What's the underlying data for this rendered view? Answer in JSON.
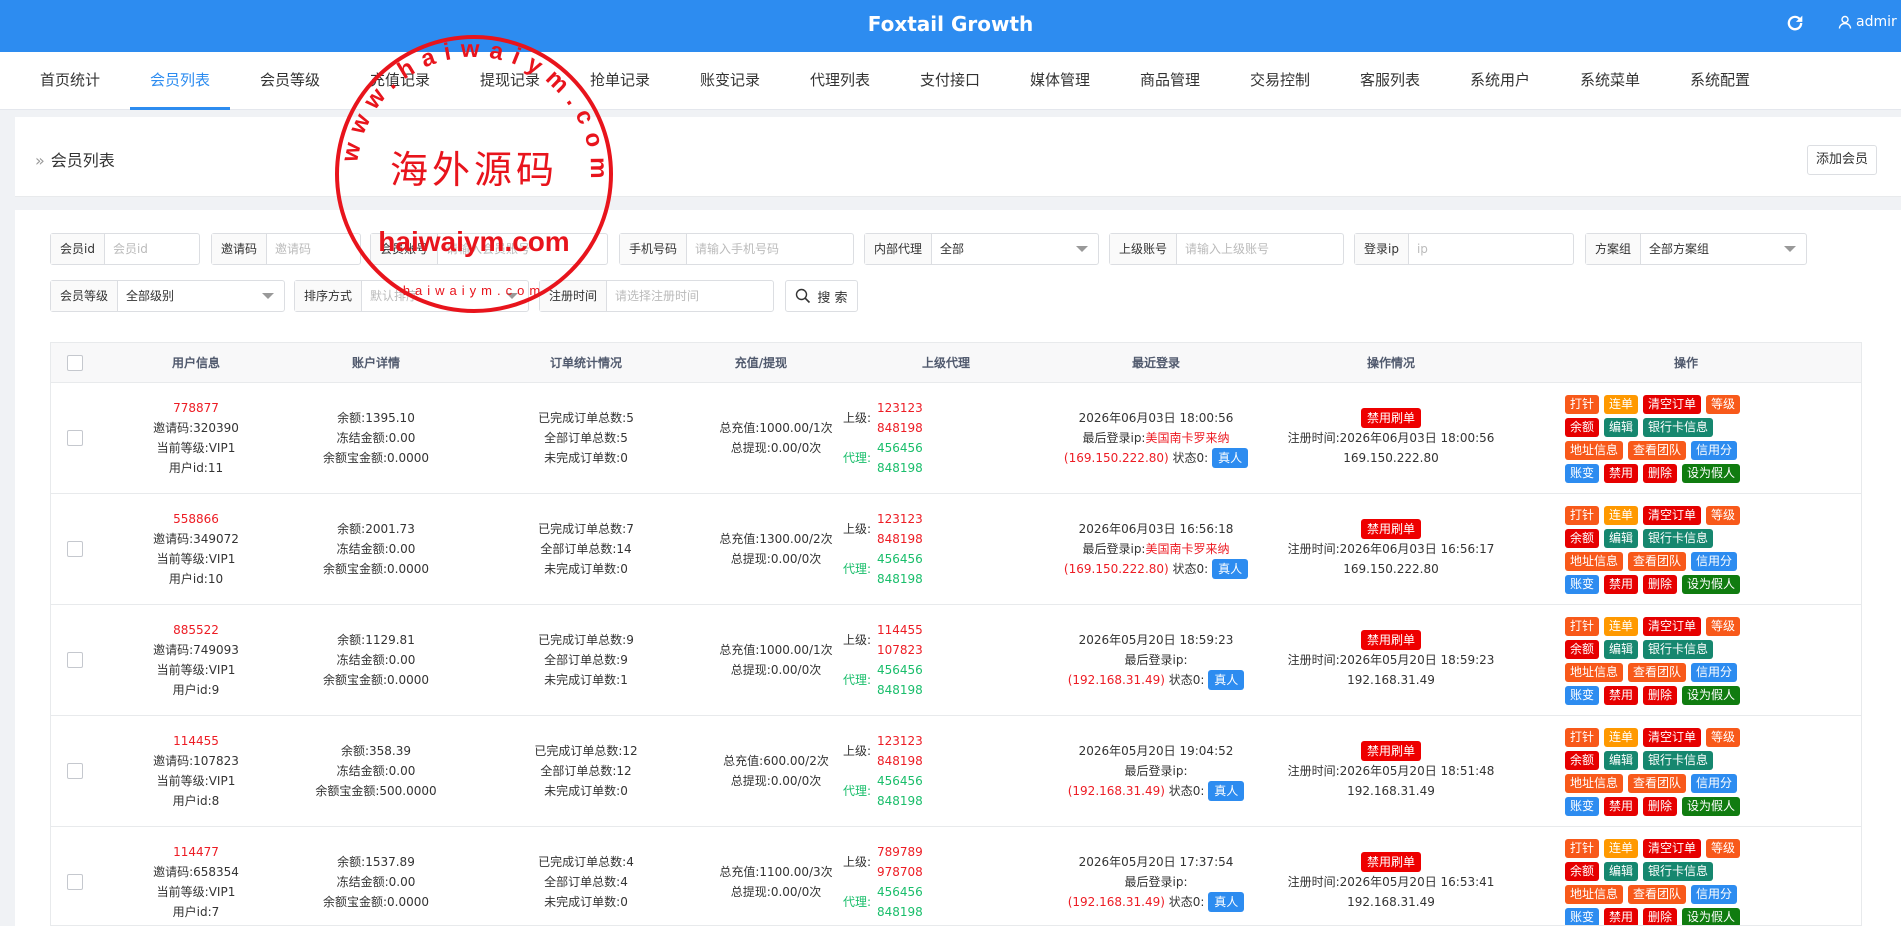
{
  "app": {
    "title": "Foxtail Growth",
    "user": "admir"
  },
  "nav": [
    "首页统计",
    "会员列表",
    "会员等级",
    "充值记录",
    "提现记录",
    "抢单记录",
    "账变记录",
    "代理列表",
    "支付接口",
    "媒体管理",
    "商品管理",
    "交易控制",
    "客服列表",
    "系统用户",
    "系统菜单",
    "系统配置"
  ],
  "page": {
    "breadcrumb": "会员列表",
    "add_button": "添加会员"
  },
  "filters": {
    "member_id": {
      "label": "会员id",
      "placeholder": "会员id"
    },
    "invite_code": {
      "label": "邀请码",
      "placeholder": "邀请码"
    },
    "account": {
      "label": "会员账号",
      "placeholder": "请输入会员账号"
    },
    "phone": {
      "label": "手机号码",
      "placeholder": "请输入手机号码"
    },
    "internal_agent": {
      "label": "内部代理",
      "value": "全部"
    },
    "parent_account": {
      "label": "上级账号",
      "placeholder": "请输入上级账号"
    },
    "login_ip": {
      "label": "登录ip",
      "placeholder": "ip"
    },
    "plan_group": {
      "label": "方案组",
      "value": "全部方案组"
    },
    "member_level": {
      "label": "会员等级",
      "value": "全部级别"
    },
    "sort": {
      "label": "排序方式",
      "value": "默认排序"
    },
    "reg_time": {
      "label": "注册时间",
      "placeholder": "请选择注册时间"
    },
    "search_button": "搜 索"
  },
  "table": {
    "headers": [
      "用户信息",
      "账户详情",
      "订单统计情况",
      "充值/提现",
      "上级代理",
      "最近登录",
      "操作情况",
      "操作"
    ],
    "labels": {
      "invite_prefix": "邀请码:",
      "level_prefix": "当前等级:",
      "uid_prefix": "用户id:",
      "balance_prefix": "余额:",
      "frozen_prefix": "冻结金额:",
      "yeb_prefix": "余额宝金额:",
      "done_prefix": "已完成订单总数:",
      "all_prefix": "全部订单总数:",
      "undone_prefix": "未完成订单数:",
      "recharge_prefix": "总充值:",
      "withdraw_prefix": "总提现:",
      "upper": "上级:",
      "agent": "代理:",
      "last_login_ip": "最后登录ip:",
      "status_label": "状态0:",
      "real": "真人",
      "ban_brush": "禁用刷单",
      "reg_time_prefix": "注册时间:"
    },
    "action_rows": [
      [
        "打针",
        "连单",
        "清空订单",
        "等级"
      ],
      [
        "余额",
        "编辑",
        "银行卡信息"
      ],
      [
        "地址信息",
        "查看团队",
        "信用分"
      ],
      [
        "账变",
        "禁用",
        "删除",
        "设为假人"
      ]
    ],
    "rows": [
      {
        "username": "778877",
        "invite": "320390",
        "level": "VIP1",
        "uid": "11",
        "balance": "1395.10",
        "frozen": "0.00",
        "yeb": "0.0000",
        "done": "5",
        "all": "5",
        "undone": "0",
        "recharge": "1000.00/1次",
        "withdraw": "0.00/0次",
        "upper": [
          "123123",
          "848198"
        ],
        "agent": [
          "456456",
          "848198"
        ],
        "login_time": "2026年06月03日 18:00:56",
        "login_loc": "美国南卡罗来纳",
        "ip": "(169.150.222.80)",
        "reg_time": "2026年06月03日 18:00:56",
        "reg_ip": "169.150.222.80"
      },
      {
        "username": "558866",
        "invite": "349072",
        "level": "VIP1",
        "uid": "10",
        "balance": "2001.73",
        "frozen": "0.00",
        "yeb": "0.0000",
        "done": "7",
        "all": "14",
        "undone": "0",
        "recharge": "1300.00/2次",
        "withdraw": "0.00/0次",
        "upper": [
          "123123",
          "848198"
        ],
        "agent": [
          "456456",
          "848198"
        ],
        "login_time": "2026年06月03日 16:56:18",
        "login_loc": "美国南卡罗来纳",
        "ip": "(169.150.222.80)",
        "reg_time": "2026年06月03日 16:56:17",
        "reg_ip": "169.150.222.80"
      },
      {
        "username": "885522",
        "invite": "749093",
        "level": "VIP1",
        "uid": "9",
        "balance": "1129.81",
        "frozen": "0.00",
        "yeb": "0.0000",
        "done": "9",
        "all": "9",
        "undone": "1",
        "recharge": "1000.00/1次",
        "withdraw": "0.00/0次",
        "upper": [
          "114455",
          "107823"
        ],
        "agent": [
          "456456",
          "848198"
        ],
        "login_time": "2026年05月20日 18:59:23",
        "login_loc": "",
        "ip": "(192.168.31.49)",
        "reg_time": "2026年05月20日 18:59:23",
        "reg_ip": "192.168.31.49"
      },
      {
        "username": "114455",
        "invite": "107823",
        "level": "VIP1",
        "uid": "8",
        "balance": "358.39",
        "frozen": "0.00",
        "yeb": "500.0000",
        "done": "12",
        "all": "12",
        "undone": "0",
        "recharge": "600.00/2次",
        "withdraw": "0.00/0次",
        "upper": [
          "123123",
          "848198"
        ],
        "agent": [
          "456456",
          "848198"
        ],
        "login_time": "2026年05月20日 19:04:52",
        "login_loc": "",
        "ip": "(192.168.31.49)",
        "reg_time": "2026年05月20日 18:51:48",
        "reg_ip": "192.168.31.49"
      },
      {
        "username": "114477",
        "invite": "658354",
        "level": "VIP1",
        "uid": "7",
        "balance": "1537.89",
        "frozen": "0.00",
        "yeb": "0.0000",
        "done": "4",
        "all": "4",
        "undone": "0",
        "recharge": "1100.00/3次",
        "withdraw": "0.00/0次",
        "upper": [
          "789789",
          "978708"
        ],
        "agent": [
          "456456",
          "848198"
        ],
        "login_time": "2026年05月20日 17:37:54",
        "login_loc": "",
        "ip": "(192.168.31.49)",
        "reg_time": "2026年05月20日 16:53:41",
        "reg_ip": "192.168.31.49"
      }
    ]
  },
  "watermark": {
    "text_cn": "海外源码",
    "text_url": "haiwaiym.com",
    "ring_text": "www.haiwaiym.com",
    "color": "#e8141c"
  }
}
